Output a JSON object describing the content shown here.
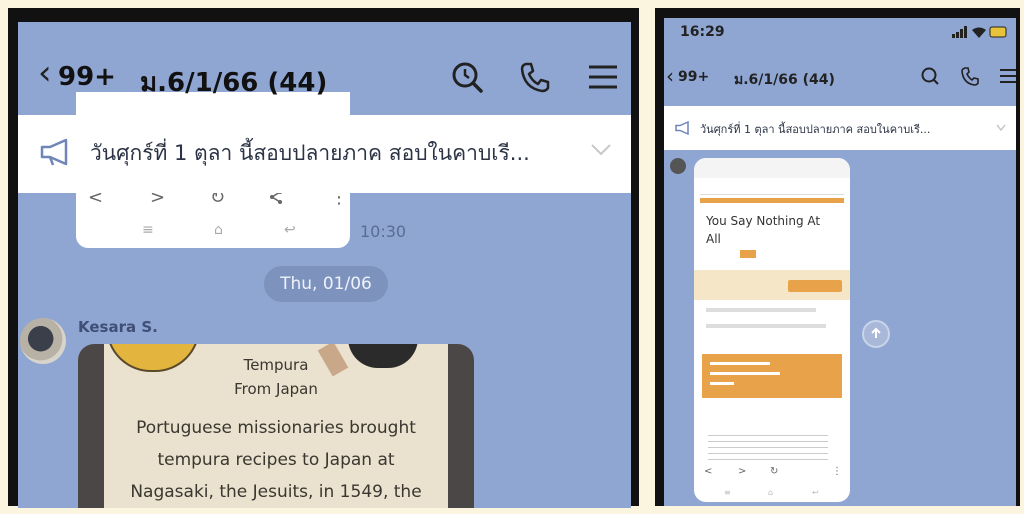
{
  "left_panel": {
    "header": {
      "count": "99+",
      "title": "ม.6/1/66 (44)",
      "icons": [
        "search-history-icon",
        "phone-icon",
        "menu-icon"
      ]
    },
    "announcement": {
      "text": "วันศุกร์ที่ 1 ตุลา  นี้สอบปลายภาค สอบในคาบเรี...",
      "icon": "megaphone-icon"
    },
    "previous_message": {
      "time": "10:30",
      "browser_controls": [
        "<",
        ">",
        "↻",
        "share",
        "⋮"
      ],
      "system_nav": [
        "≡",
        "⌂",
        "↩"
      ]
    },
    "date_divider": "Thu, 01/06",
    "message": {
      "sender": "Kesara S.",
      "image_text": {
        "line1": "Tempura",
        "line2": "From Japan",
        "body": [
          "Portuguese missionaries brought",
          "tempura recipes to Japan at",
          "Nagasaki, the Jesuits, in 1549, the"
        ]
      }
    }
  },
  "right_panel": {
    "status_bar": {
      "time": "16:29"
    },
    "header": {
      "count": "99+",
      "title": "ม.6/1/66 (44)"
    },
    "announcement": {
      "text": "วันศุกร์ที่ 1 ตุลา  นี้สอบปลายภาค สอบในคาบเรี..."
    },
    "phone_screenshot": {
      "title": "You Say Nothing At All"
    },
    "share_icon": "share-icon"
  }
}
